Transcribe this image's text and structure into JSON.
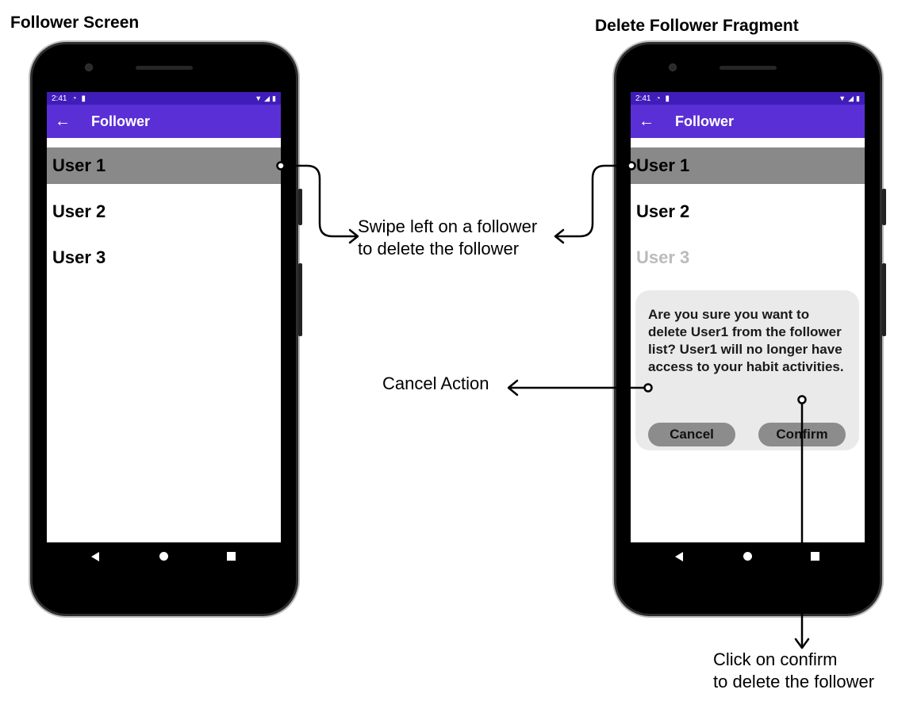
{
  "left_heading": "Follower Screen",
  "right_heading": "Delete Follower Fragment",
  "status_bar": {
    "time": "2:41"
  },
  "app_bar": {
    "back_icon": "arrow-left-icon",
    "title": "Follower"
  },
  "users": [
    "User 1",
    "User 2",
    "User 3"
  ],
  "dialog": {
    "message": "Are you sure you want to delete User1 from the follower list? User1 will no longer have access to your habit activities.",
    "cancel_label": "Cancel",
    "confirm_label": "Confirm"
  },
  "annotations": {
    "swipe": [
      "Swipe left on a follower",
      "to delete the follower"
    ],
    "cancel": "Cancel Action",
    "confirm": [
      "Click on confirm",
      "to delete the follower"
    ]
  },
  "colors": {
    "app_bar": "#5b2fd6",
    "status_bar": "#3f1db8",
    "selected_row": "#898989",
    "dialog": "#e9e9e9",
    "dialog_button": "#8c8c8c"
  }
}
